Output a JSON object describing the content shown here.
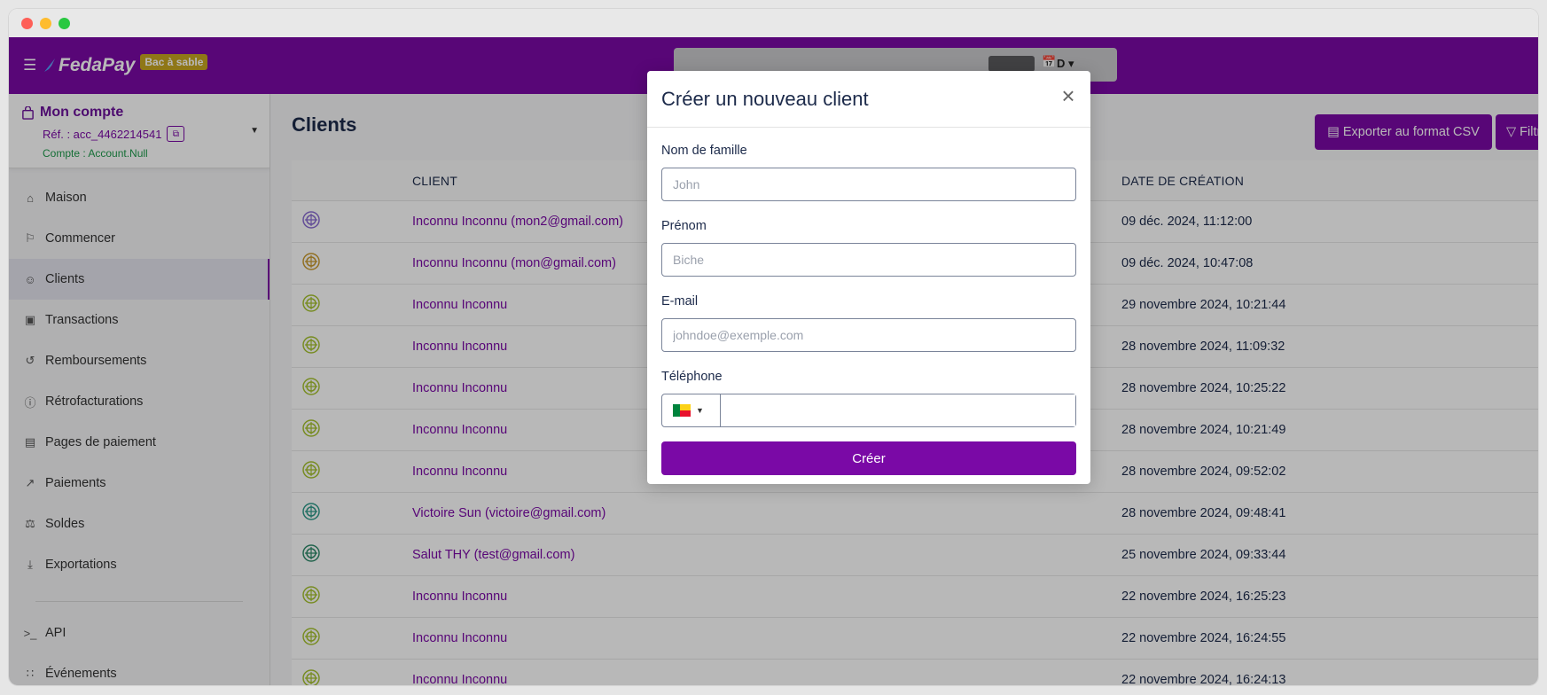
{
  "topbar": {
    "logo_text": "FedaPay",
    "sandbox_badge": "Bac à sable",
    "period_label": "D"
  },
  "account": {
    "title": "Mon compte",
    "ref": "Réf. : acc_4462214541",
    "status": "Compte : Account.Null"
  },
  "sidebar": {
    "items": [
      {
        "label": "Maison",
        "icon": "home-icon"
      },
      {
        "label": "Commencer",
        "icon": "flag-icon"
      },
      {
        "label": "Clients",
        "icon": "user-circle-icon",
        "active": true
      },
      {
        "label": "Transactions",
        "icon": "money-icon"
      },
      {
        "label": "Remboursements",
        "icon": "refund-icon"
      },
      {
        "label": "Rétrofacturations",
        "icon": "alert-circle-icon"
      },
      {
        "label": "Pages de paiement",
        "icon": "document-icon"
      },
      {
        "label": "Paiements",
        "icon": "external-link-icon"
      },
      {
        "label": "Soldes",
        "icon": "balance-scale-icon"
      },
      {
        "label": "Exportations",
        "icon": "download-icon"
      }
    ],
    "bottom_items": [
      {
        "label": "API",
        "icon": "terminal-icon"
      },
      {
        "label": "Événements",
        "icon": "rss-icon"
      }
    ]
  },
  "main": {
    "title": "Clients",
    "export_label": "Exporter au format CSV",
    "filter_label": "Filtr",
    "columns": {
      "client": "CLIENT",
      "date": "DATE DE CRÉATION"
    },
    "rows": [
      {
        "client": "Inconnu Inconnu (mon2@gmail.com)",
        "date": "09 déc. 2024, 11:12:00",
        "avatar_color": "#8a6bd1"
      },
      {
        "client": "Inconnu Inconnu (mon@gmail.com)",
        "date": "09 déc. 2024, 10:47:08",
        "avatar_color": "#c99a2e"
      },
      {
        "client": "Inconnu Inconnu",
        "date": "29 novembre 2024, 10:21:44",
        "avatar_color": "#a6c22e"
      },
      {
        "client": "Inconnu Inconnu",
        "date": "28 novembre 2024, 11:09:32",
        "avatar_color": "#a6c22e"
      },
      {
        "client": "Inconnu Inconnu",
        "date": "28 novembre 2024, 10:25:22",
        "avatar_color": "#a6c22e"
      },
      {
        "client": "Inconnu Inconnu",
        "date": "28 novembre 2024, 10:21:49",
        "avatar_color": "#a6c22e"
      },
      {
        "client": "Inconnu Inconnu",
        "date": "28 novembre 2024, 09:52:02",
        "avatar_color": "#a6c22e"
      },
      {
        "client": "Victoire Sun (victoire@gmail.com)",
        "date": "28 novembre 2024, 09:48:41",
        "avatar_color": "#2e9a8a"
      },
      {
        "client": "Salut THY (test@gmail.com)",
        "date": "25 novembre 2024, 09:33:44",
        "avatar_color": "#2e8a6a"
      },
      {
        "client": "Inconnu Inconnu",
        "date": "22 novembre 2024, 16:25:23",
        "avatar_color": "#a6c22e"
      },
      {
        "client": "Inconnu Inconnu",
        "date": "22 novembre 2024, 16:24:55",
        "avatar_color": "#a6c22e"
      },
      {
        "client": "Inconnu Inconnu",
        "date": "22 novembre 2024, 16:24:13",
        "avatar_color": "#a6c22e"
      }
    ]
  },
  "modal": {
    "title": "Créer un nouveau client",
    "last_name_label": "Nom de famille",
    "last_name_placeholder": "John",
    "first_name_label": "Prénom",
    "first_name_placeholder": "Biche",
    "email_label": "E-mail",
    "email_placeholder": "johndoe@exemple.com",
    "phone_label": "Téléphone",
    "phone_value": "",
    "submit_label": "Créer"
  },
  "colors": {
    "brand": "#7a09a6",
    "text_dark": "#1c2a4a",
    "status_green": "#1e9a4c",
    "badge_gold": "#c7a521"
  }
}
